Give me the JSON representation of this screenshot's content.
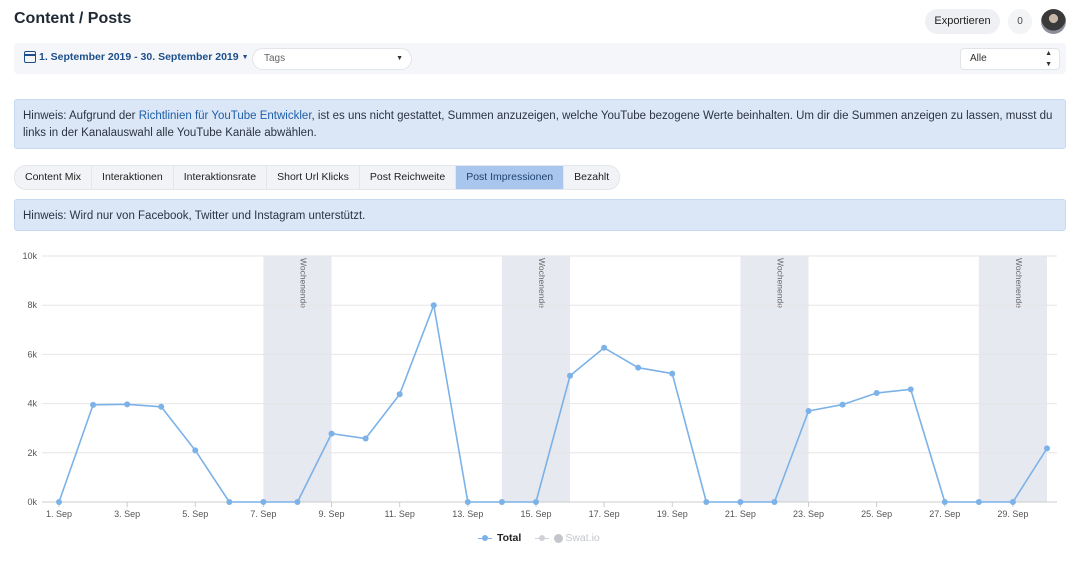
{
  "header": {
    "title": "Content / Posts",
    "export_label": "Exportieren",
    "count": "0"
  },
  "filters": {
    "date_range": "1. September 2019 - 30. September 2019",
    "tags_placeholder": "Tags",
    "network_select": "Alle"
  },
  "notice_youtube": {
    "before": "Hinweis: Aufgrund der ",
    "link": "Richtlinien für YouTube Entwickler",
    "after": ", ist es uns nicht gestattet, Summen anzuzeigen, welche YouTube bezogene Werte beinhalten. Um dir die Summen anzeigen zu lassen, musst du links in der Kanalauswahl alle YouTube Kanäle abwählen."
  },
  "tabs": [
    "Content Mix",
    "Interaktionen",
    "Interaktionsrate",
    "Short Url Klicks",
    "Post Reichweite",
    "Post Impressionen",
    "Bezahlt"
  ],
  "active_tab": "Post Impressionen",
  "notice_platforms": "Hinweis: Wird nur von Facebook, Twitter und Instagram unterstützt.",
  "colors": {
    "series_total": "#7cb2e8",
    "weekend_band": "#e6e9f0",
    "grid": "#e6e6e6"
  },
  "chart_data": {
    "type": "line",
    "x": [
      1,
      2,
      3,
      4,
      5,
      6,
      7,
      8,
      9,
      10,
      11,
      12,
      13,
      14,
      15,
      16,
      17,
      18,
      19,
      20,
      21,
      22,
      23,
      24,
      25,
      26,
      27,
      28,
      29,
      30
    ],
    "x_tick_labels": [
      "1. Sep",
      "3. Sep",
      "5. Sep",
      "7. Sep",
      "9. Sep",
      "11. Sep",
      "13. Sep",
      "15. Sep",
      "17. Sep",
      "19. Sep",
      "21. Sep",
      "23. Sep",
      "25. Sep",
      "27. Sep",
      "29. Sep"
    ],
    "x_tick_days": [
      1,
      3,
      5,
      7,
      9,
      11,
      13,
      15,
      17,
      19,
      21,
      23,
      25,
      27,
      29
    ],
    "y_tick_labels": [
      "0k",
      "2k",
      "4k",
      "6k",
      "8k",
      "10k"
    ],
    "y_tick_values": [
      0,
      2000,
      4000,
      6000,
      8000,
      10000
    ],
    "ylim": [
      0,
      10000
    ],
    "xlim": [
      1,
      30
    ],
    "series": [
      {
        "name": "Total",
        "values": [
          0,
          3950,
          3970,
          3870,
          2100,
          0,
          0,
          0,
          2780,
          2580,
          4380,
          8000,
          0,
          0,
          0,
          5130,
          6270,
          5460,
          5220,
          0,
          0,
          0,
          3700,
          3960,
          4430,
          4580,
          0,
          0,
          0,
          2180
        ]
      }
    ],
    "legend": [
      "Total",
      "Swat.io"
    ],
    "legend_position": "bottom-center",
    "weekend_bands": [
      {
        "label": "Wochenende",
        "start": 7,
        "end": 9
      },
      {
        "label": "Wochenende",
        "start": 14,
        "end": 16
      },
      {
        "label": "Wochenende",
        "start": 21,
        "end": 23
      },
      {
        "label": "Wochenende",
        "start": 28,
        "end": 30
      }
    ],
    "grid": true
  }
}
